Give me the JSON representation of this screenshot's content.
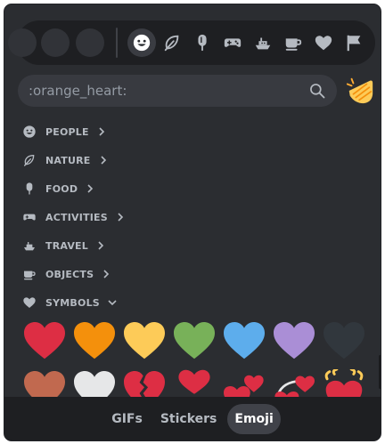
{
  "search": {
    "value": "",
    "placeholder": ":orange_heart:"
  },
  "categories": [
    {
      "name": "people",
      "label": "PEOPLE",
      "expanded": false
    },
    {
      "name": "nature",
      "label": "NATURE",
      "expanded": false
    },
    {
      "name": "food",
      "label": "FOOD",
      "expanded": false
    },
    {
      "name": "activities",
      "label": "ACTIVITIES",
      "expanded": false
    },
    {
      "name": "travel",
      "label": "TRAVEL",
      "expanded": false
    },
    {
      "name": "objects",
      "label": "OBJECTS",
      "expanded": false
    },
    {
      "name": "symbols",
      "label": "SYMBOLS",
      "expanded": true
    }
  ],
  "category_bar": {
    "active": "people",
    "icons": [
      "smiley-icon",
      "leaf-icon",
      "popsicle-icon",
      "gamepad-icon",
      "boat-icon",
      "coffee-icon",
      "heart-icon",
      "flag-icon"
    ]
  },
  "emoji_rows": [
    [
      "red-heart",
      "orange-heart",
      "yellow-heart",
      "green-heart",
      "blue-heart",
      "purple-heart",
      "black-heart"
    ],
    [
      "brown-heart",
      "white-heart",
      "broken-heart",
      "heart-exclamation",
      "two-hearts",
      "revolving-hearts",
      "beating-heart"
    ]
  ],
  "colors": {
    "red": "#dd2e44",
    "orange": "#f4900c",
    "yellow": "#fdcb58",
    "green": "#78b159",
    "blue": "#5dadec",
    "purple": "#aa8ed6",
    "black": "#31373d",
    "brown": "#c1694f",
    "white": "#e6e7e8"
  },
  "tabs": [
    {
      "label": "GIFs",
      "active": false
    },
    {
      "label": "Stickers",
      "active": false
    },
    {
      "label": "Emoji",
      "active": true
    }
  ],
  "skin_tone_button_icon": "clapping-hands-icon"
}
